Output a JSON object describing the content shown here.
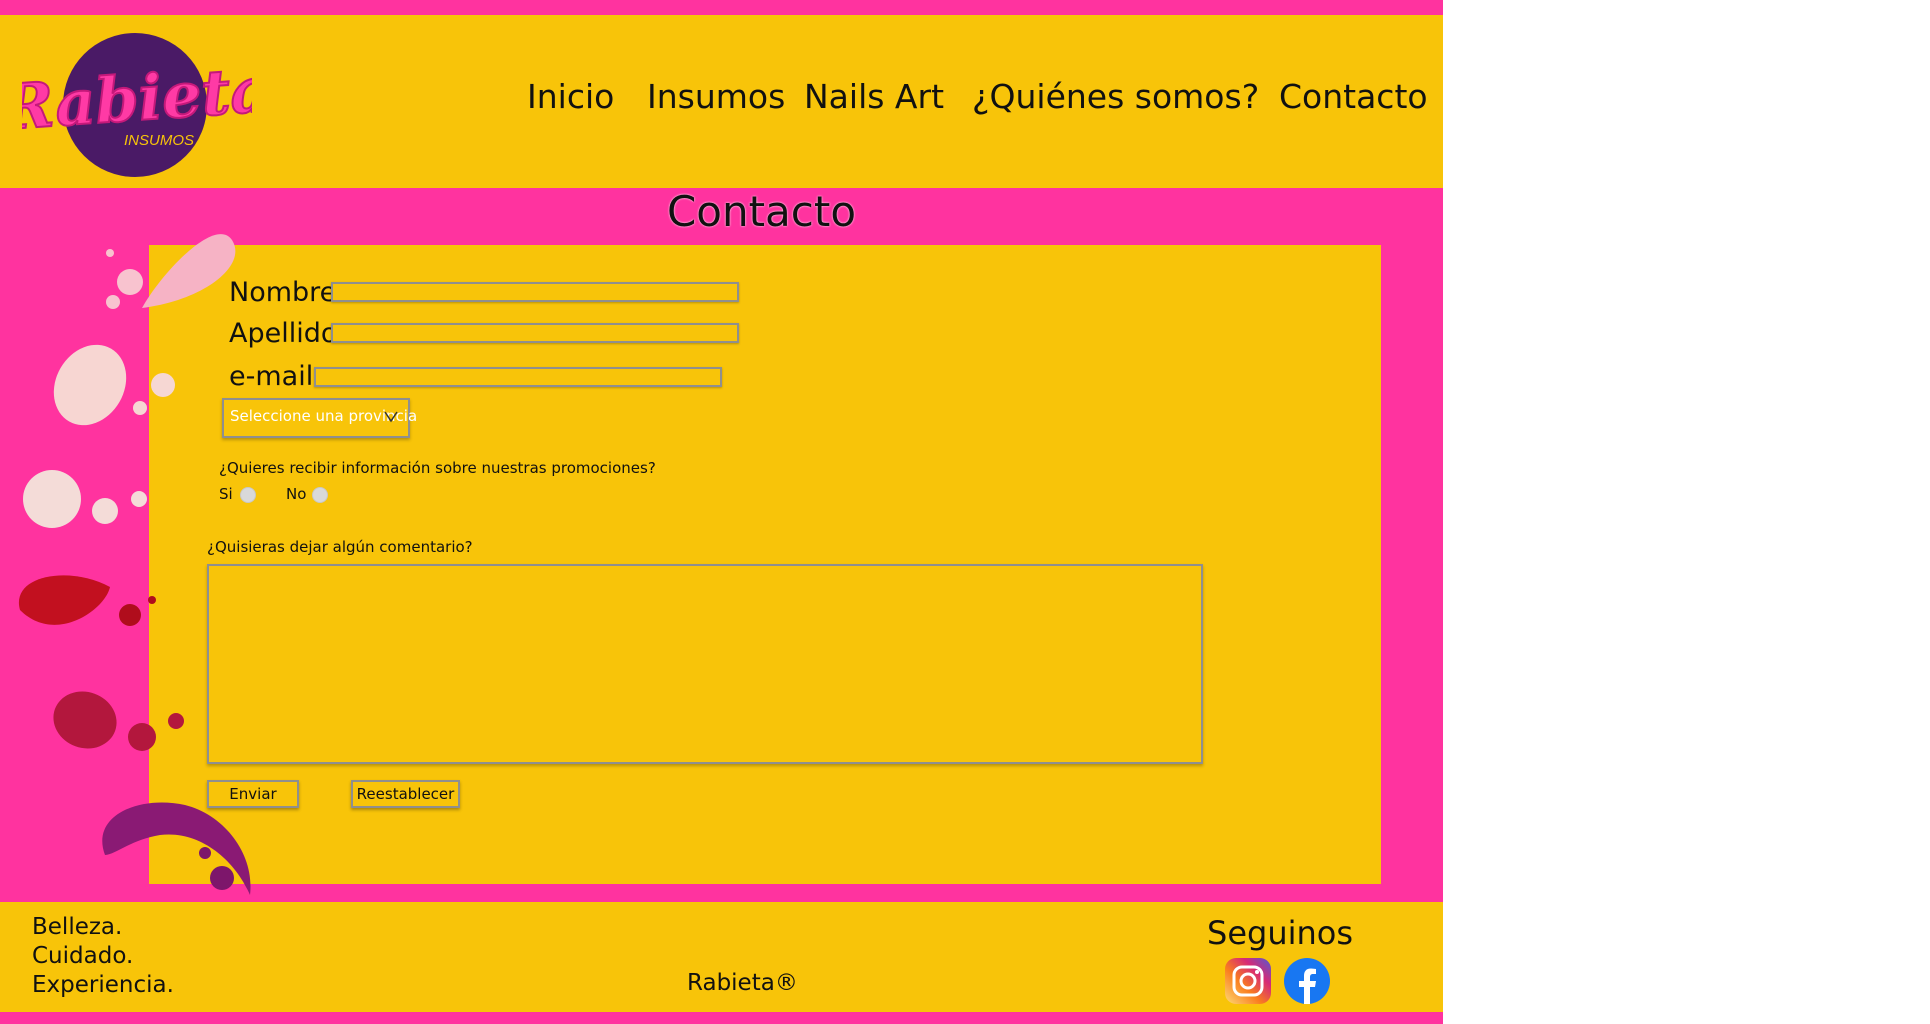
{
  "brand": {
    "logo_text": "Rabieta",
    "logo_sub": "INSUMOS"
  },
  "nav": {
    "items": [
      "Inicio",
      "Insumos",
      "Nails Art",
      "¿Quiénes somos?",
      "Contacto"
    ]
  },
  "page": {
    "title": "Contacto"
  },
  "form": {
    "nombre_label": "Nombre",
    "apellido_label": "Apellido",
    "email_label": "e-mail",
    "nombre_value": "",
    "apellido_value": "",
    "email_value": "",
    "province_select": "Seleccione una provincia",
    "promo_question": "¿Quieres recibir información sobre nuestras promociones?",
    "radio_yes": "Si",
    "radio_no": "No",
    "comment_question": "¿Quisieras dejar algún comentario?",
    "comment_value": "",
    "submit_label": "Enviar",
    "reset_label": "Reestablecer"
  },
  "footer": {
    "slogan": [
      "Belleza.",
      "Cuidado.",
      "Experiencia."
    ],
    "brand_mark": "Rabieta®",
    "follow_title": "Seguinos",
    "social": [
      "instagram-icon",
      "facebook-icon"
    ]
  },
  "colors": {
    "pink": "#ff339f",
    "yellow": "#f8c409",
    "logo_purple": "#4a1a66",
    "logo_pink": "#ff3aa5",
    "facebook_blue": "#1877f2"
  }
}
